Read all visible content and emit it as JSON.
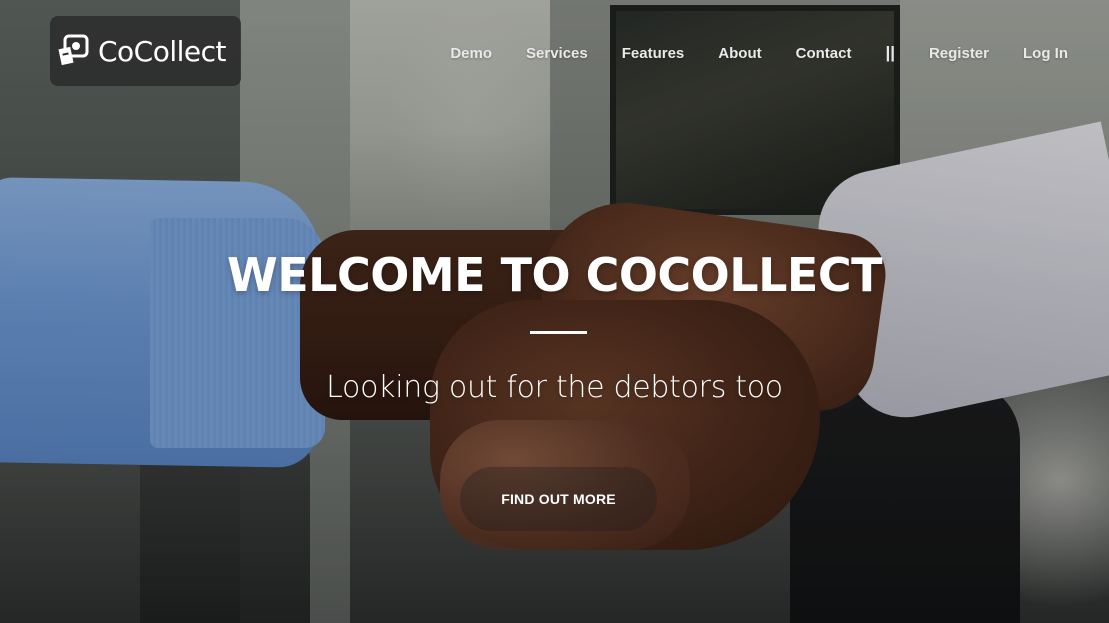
{
  "brand": {
    "name": "CoCollect",
    "logo_icon": "cocollect-logo-icon"
  },
  "nav": {
    "items": [
      {
        "label": "Demo"
      },
      {
        "label": "Services"
      },
      {
        "label": "Features"
      },
      {
        "label": "About"
      },
      {
        "label": "Contact"
      }
    ],
    "separator": "||",
    "register_label": "Register",
    "login_label": "Log In"
  },
  "hero": {
    "title": "WELCOME TO COCOLLECT",
    "subtitle": "Looking out for the debtors too",
    "cta_label": "FIND OUT MORE",
    "background": "handshake-photo"
  },
  "colors": {
    "text": "#ffffff",
    "nav_text": "#e9e9e9",
    "brand_bg": "#282828"
  }
}
